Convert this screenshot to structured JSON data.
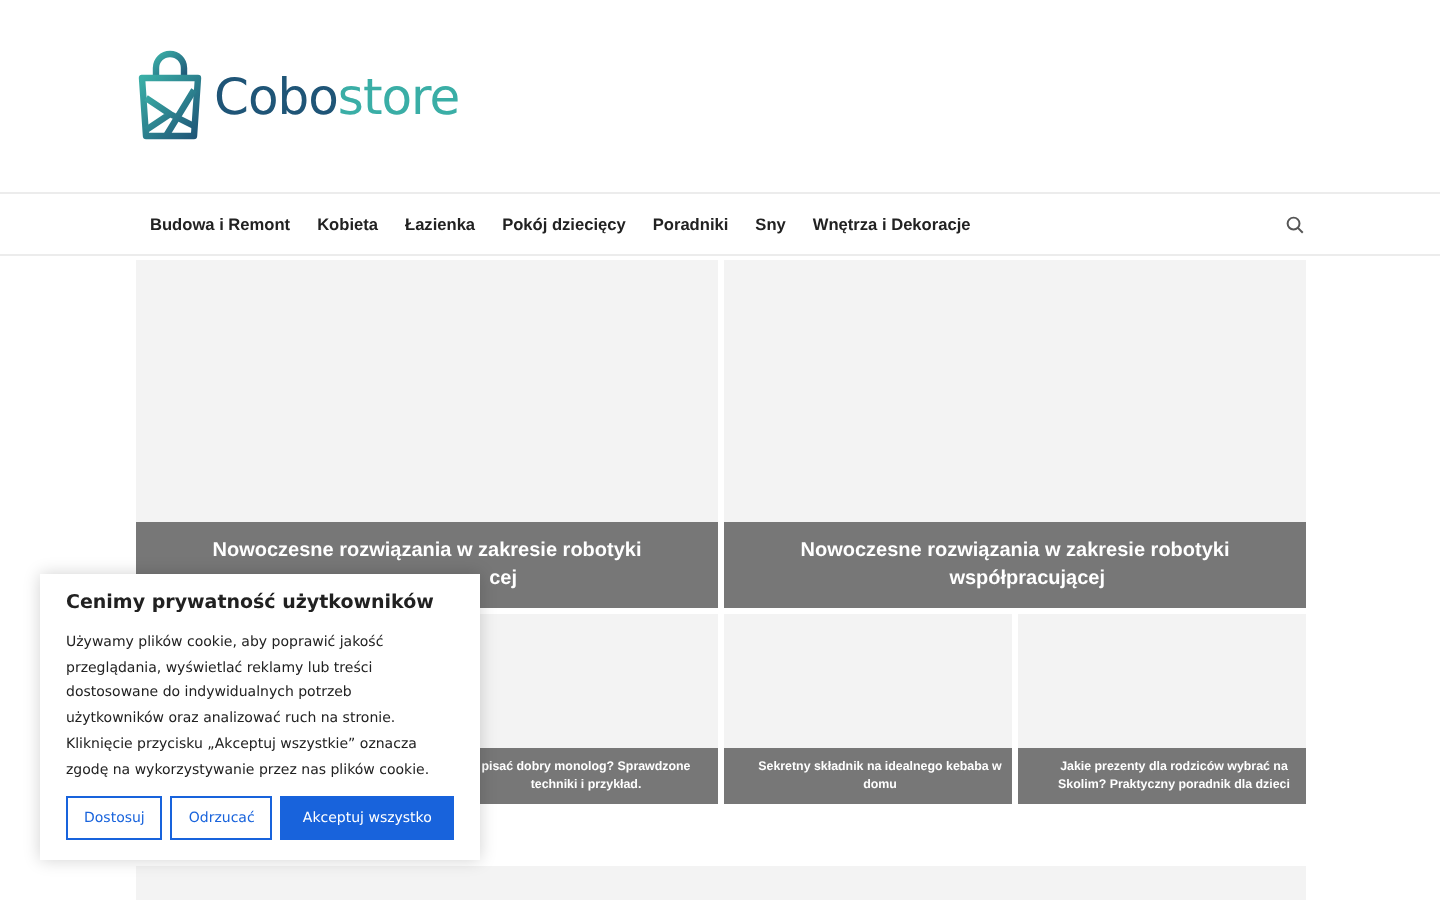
{
  "logo": {
    "part_1": "Cobo",
    "part_2": "store"
  },
  "nav": {
    "items": [
      {
        "label": "Budowa i Remont"
      },
      {
        "label": "Kobieta"
      },
      {
        "label": "Łazienka"
      },
      {
        "label": "Pokój dziecięcy"
      },
      {
        "label": "Poradniki"
      },
      {
        "label": "Sny"
      },
      {
        "label": "Wnętrza i Dekoracje"
      }
    ]
  },
  "featured": [
    {
      "title_lines": [
        "Nowoczesne rozwiązania w zakresie robotyki",
        "cej"
      ]
    },
    {
      "title_lines": [
        "Nowoczesne rozwiązania w zakresie robotyki",
        "współpracującej"
      ]
    }
  ],
  "small_cards": [
    {
      "title_lines": [
        "pisać dobry monolog? Sprawdzone",
        "techniki i przykład."
      ]
    },
    {
      "title_lines": [
        "Sekretny składnik na idealnego kebaba w",
        "domu"
      ]
    },
    {
      "title_lines": [
        "Jakie prezenty dla rodziców wybrać na",
        "Skolim? Praktyczny poradnik dla dzieci"
      ]
    }
  ],
  "cookie": {
    "title": "Cenimy prywatność użytkowników",
    "body": "Używamy plików cookie, aby poprawić jakość przeglądania, wyświetlać reklamy lub treści dostosowane do indywidualnych potrzeb użytkowników oraz analizować ruch na stronie. Kliknięcie przycisku „Akceptuj wszystkie” oznacza zgodę na wykorzystywanie przez nas plików cookie.",
    "buttons": [
      {
        "label": "Dostosuj",
        "kind": "outline"
      },
      {
        "label": "Odrzucać",
        "kind": "outline"
      },
      {
        "label": "Akceptuj wszystko",
        "kind": "primary"
      }
    ]
  }
}
